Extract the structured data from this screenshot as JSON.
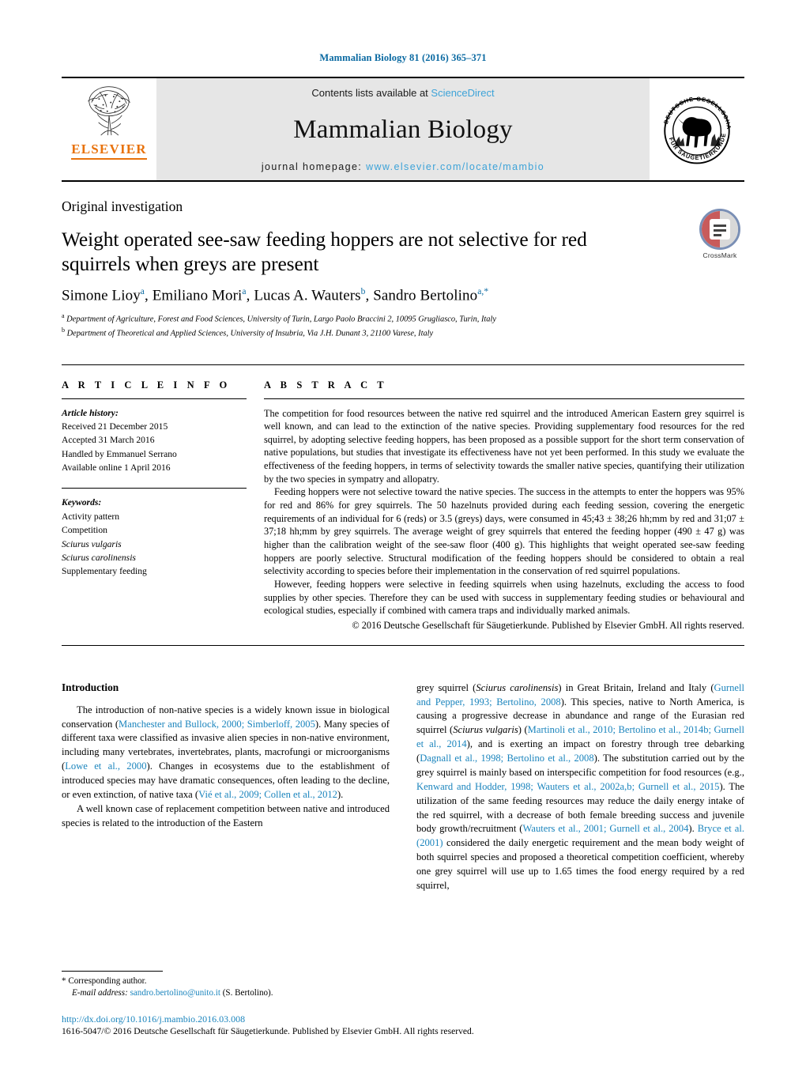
{
  "running_head": "Mammalian Biology 81 (2016) 365–371",
  "masthead": {
    "contents_prefix": "Contents lists available at ",
    "sciencedirect": "ScienceDirect",
    "journal_title": "Mammalian Biology",
    "homepage_prefix": "journal homepage: ",
    "homepage_url": "www.elsevier.com/locate/mambio",
    "publisher_wordmark": "ELSEVIER",
    "publisher_logo_name": "elsevier-tree-logo",
    "society_logo_name": "deutsche-gesellschaft-fuer-saeugetierkunde-seal",
    "society_logo_text": "DEUTSCHE GESELLSCHAFT FÜR SÄUGETIERKUNDE"
  },
  "article": {
    "section_type": "Original investigation",
    "title": "Weight operated see-saw feeding hoppers are not selective for red squirrels when greys are present",
    "authors_html": "Simone Lioy<sup>a</sup>, Emiliano Mori<sup>a</sup>, Lucas A. Wauters<sup>b</sup>, Sandro Bertolino<sup>a,*</sup>",
    "affiliation_a": "Department of Agriculture, Forest and Food Sciences, University of Turin, Largo Paolo Braccini 2, 10095 Grugliasco, Turin, Italy",
    "affiliation_b": "Department of Theoretical and Applied Sciences, University of Insubria, Via J.H. Dunant 3, 21100 Varese, Italy",
    "crossmark_label": "CrossMark"
  },
  "info": {
    "heading": "A R T I C L E    I N F O",
    "history_label": "Article history:",
    "history": [
      "Received 21 December 2015",
      "Accepted 31 March 2016",
      "Handled by Emmanuel Serrano",
      "Available online 1 April 2016"
    ],
    "keywords_label": "Keywords:",
    "keywords": [
      "Activity pattern",
      "Competition",
      "Sciurus vulgaris",
      "Sciurus carolinensis",
      "Supplementary feeding"
    ],
    "keywords_italic": [
      false,
      false,
      true,
      true,
      false
    ]
  },
  "abstract": {
    "heading": "A B S T R A C T",
    "p1": "The competition for food resources between the native red squirrel and the introduced American Eastern grey squirrel is well known, and can lead to the extinction of the native species. Providing supplementary food resources for the red squirrel, by adopting selective feeding hoppers, has been proposed as a possible support for the short term conservation of native populations, but studies that investigate its effectiveness have not yet been performed. In this study we evaluate the effectiveness of the feeding hoppers, in terms of selectivity towards the smaller native species, quantifying their utilization by the two species in sympatry and allopatry.",
    "p2": "Feeding hoppers were not selective toward the native species. The success in the attempts to enter the hoppers was 95% for red and 86% for grey squirrels. The 50 hazelnuts provided during each feeding session, covering the energetic requirements of an individual for 6 (reds) or 3.5 (greys) days, were consumed in 45;43 ± 38;26 hh;mm by red and 31;07 ± 37;18 hh;mm by grey squirrels. The average weight of grey squirrels that entered the feeding hopper (490 ± 47 g) was higher than the calibration weight of the see-saw floor (400 g). This highlights that weight operated see-saw feeding hoppers are poorly selective. Structural modification of the feeding hoppers should be considered to obtain a real selectivity according to species before their implementation in the conservation of red squirrel populations.",
    "p3": "However, feeding hoppers were selective in feeding squirrels when using hazelnuts, excluding the access to food supplies by other species. Therefore they can be used with success in supplementary feeding studies or behavioural and ecological studies, especially if combined with camera traps and individually marked animals.",
    "copyright": "© 2016 Deutsche Gesellschaft für Säugetierkunde. Published by Elsevier GmbH. All rights reserved."
  },
  "introduction": {
    "heading": "Introduction",
    "left_p1_html": "The introduction of non-native species is a widely known issue in biological conservation (<span class=\"ref\">Manchester and Bullock, 2000; Simberloff, 2005</span>). Many species of different taxa were classified as invasive alien species in non-native environment, including many vertebrates, invertebrates, plants, macrofungi or microorganisms (<span class=\"ref\">Lowe et al., 2000</span>). Changes in ecosystems due to the establishment of introduced species may have dramatic consequences, often leading to the decline, or even extinction, of native taxa (<span class=\"ref\">Vié et al., 2009; Collen et al., 2012</span>).",
    "left_p2_html": "A well known case of replacement competition between native and introduced species is related to the introduction of the Eastern",
    "right_p1_html": "grey squirrel (<span class=\"sp\">Sciurus carolinensis</span>) in Great Britain, Ireland and Italy (<span class=\"ref\">Gurnell and Pepper, 1993; Bertolino, 2008</span>). This species, native to North America, is causing a progressive decrease in abundance and range of the Eurasian red squirrel (<span class=\"sp\">Sciurus vulgaris</span>) (<span class=\"ref\">Martinoli et al., 2010; Bertolino et al., 2014b; Gurnell et al., 2014</span>), and is exerting an impact on forestry through tree debarking (<span class=\"ref\">Dagnall et al., 1998; Bertolino et al., 2008</span>). The substitution carried out by the grey squirrel is mainly based on interspecific competition for food resources (e.g., <span class=\"ref\">Kenward and Hodder, 1998; Wauters et al., 2002a,b; Gurnell et al., 2015</span>). The utilization of the same feeding resources may reduce the daily energy intake of the red squirrel, with a decrease of both female breeding success and juvenile body growth/recruitment (<span class=\"ref\">Wauters et al., 2001; Gurnell et al., 2004</span>). <span class=\"ref\">Bryce et al. (2001)</span> considered the daily energetic requirement and the mean body weight of both squirrel species and proposed a theoretical competition coefficient, whereby one grey squirrel will use up to 1.65 times the food energy required by a red squirrel,"
  },
  "footnote": {
    "corresponding": "* Corresponding author.",
    "email_label": "E-mail address:",
    "email": "sandro.bertolino@unito.it",
    "email_suffix": "(S. Bertolino)."
  },
  "page_footer": {
    "doi": "http://dx.doi.org/10.1016/j.mambio.2016.03.008",
    "issn_line": "1616-5047/© 2016 Deutsche Gesellschaft für Säugetierkunde. Published by Elsevier GmbH. All rights reserved."
  },
  "colors": {
    "link_blue": "#1a84bd",
    "running_head_blue": "#0b6aa2",
    "sciencedirect_blue": "#3da3d8",
    "elsevier_orange": "#e8720c",
    "band_grey": "#e6e6e6"
  }
}
